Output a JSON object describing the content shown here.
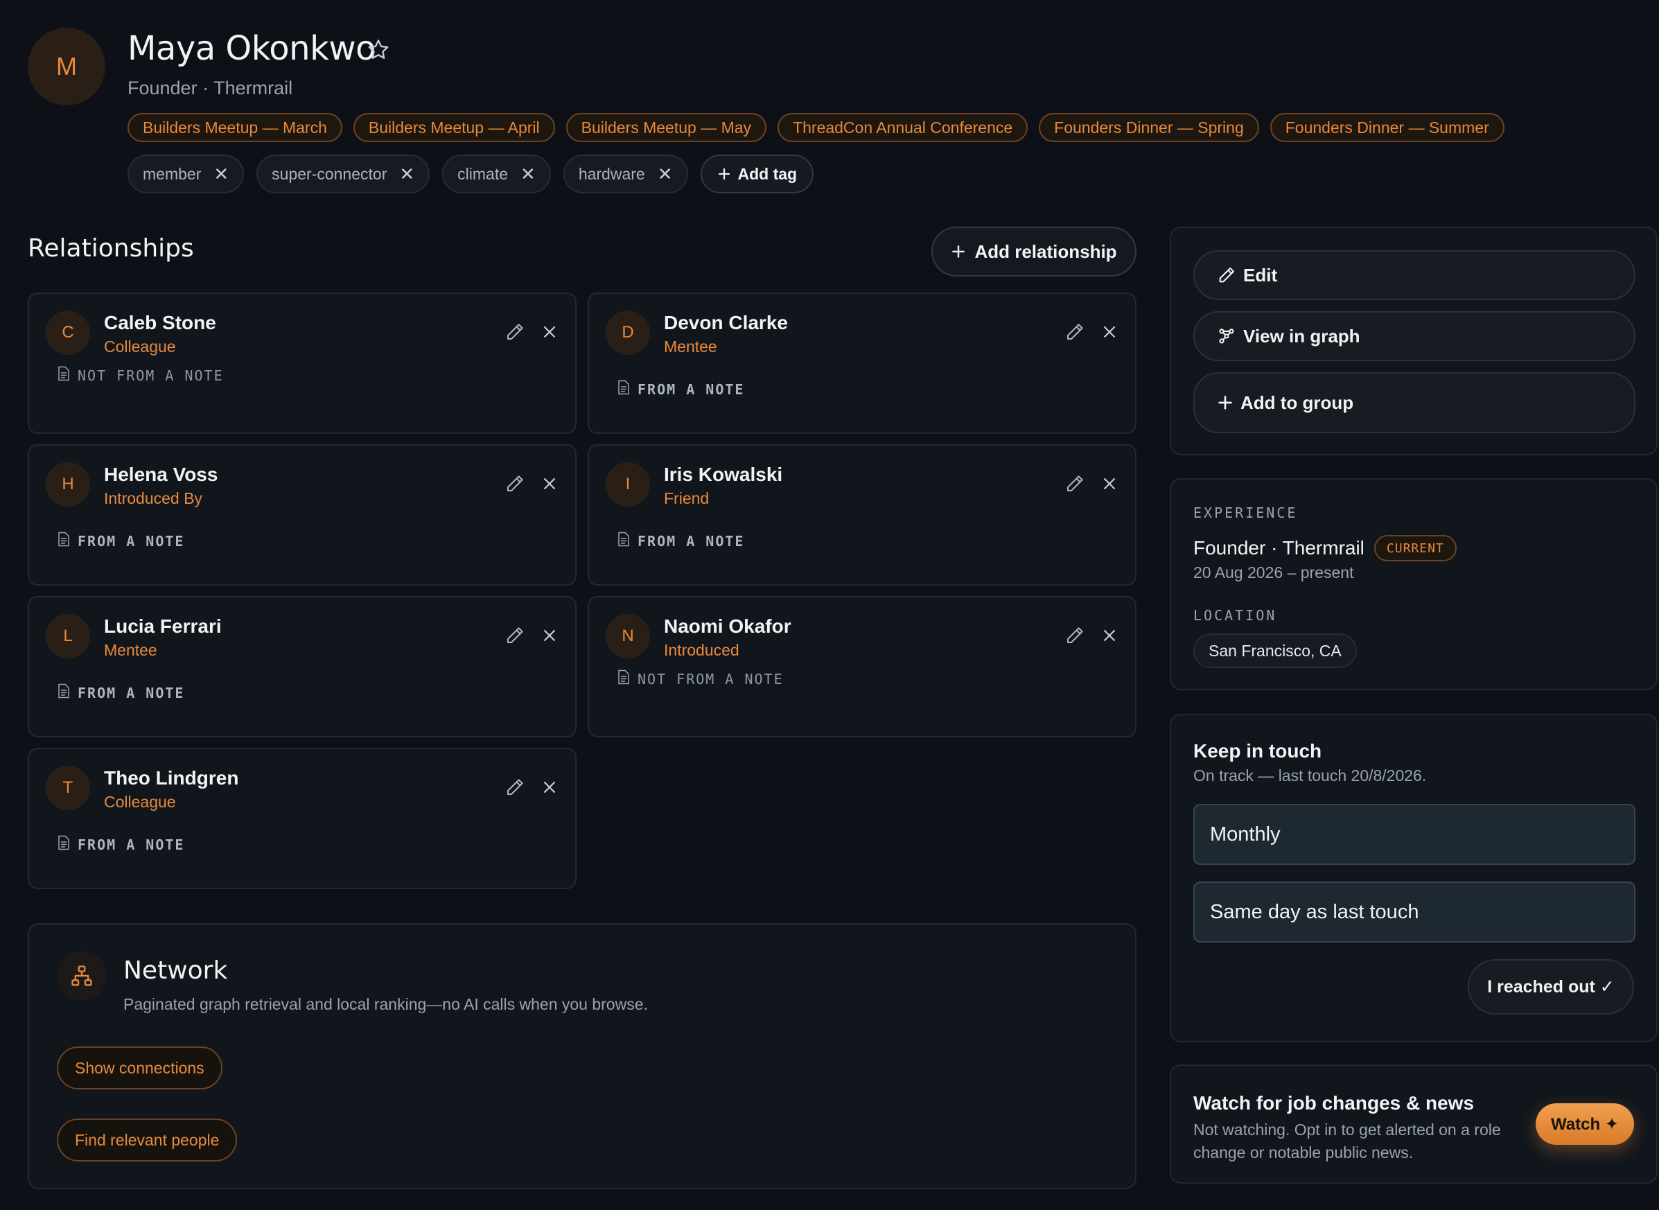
{
  "profile": {
    "initial": "M",
    "name": "Maya Okonkwo",
    "subtitle": "Founder · Thermrail"
  },
  "events": [
    "Builders Meetup — March",
    "Builders Meetup — April",
    "Builders Meetup — May",
    "ThreadCon Annual Conference",
    "Founders Dinner — Spring",
    "Founders Dinner — Summer"
  ],
  "tags": [
    "member",
    "super-connector",
    "climate",
    "hardware"
  ],
  "tag_remove_glyph": "✕",
  "add_tag_label": "Add tag",
  "relationships": {
    "title": "Relationships",
    "add_label": "Add relationship",
    "cards": [
      {
        "initial": "C",
        "name": "Caleb Stone",
        "role": "Colleague",
        "note": "NOT FROM A NOTE"
      },
      {
        "initial": "D",
        "name": "Devon Clarke",
        "role": "Mentee",
        "note": "FROM A NOTE"
      },
      {
        "initial": "H",
        "name": "Helena Voss",
        "role": "Introduced By",
        "note": "FROM A NOTE"
      },
      {
        "initial": "I",
        "name": "Iris Kowalski",
        "role": "Friend",
        "note": "FROM A NOTE"
      },
      {
        "initial": "L",
        "name": "Lucia Ferrari",
        "role": "Mentee",
        "note": "FROM A NOTE"
      },
      {
        "initial": "N",
        "name": "Naomi Okafor",
        "role": "Introduced",
        "note": "NOT FROM A NOTE"
      },
      {
        "initial": "T",
        "name": "Theo Lindgren",
        "role": "Colleague",
        "note": "FROM A NOTE"
      }
    ]
  },
  "network": {
    "title": "Network",
    "description": "Paginated graph retrieval and local ranking—no AI calls when you browse.",
    "show_connections": "Show connections",
    "find_people": "Find relevant people"
  },
  "actions": {
    "edit": "Edit",
    "view_graph": "View in graph",
    "add_group": "Add to group"
  },
  "experience": {
    "label": "EXPERIENCE",
    "title": "Founder · Thermrail",
    "badge": "CURRENT",
    "dates": "20 Aug 2026 – present",
    "location_label": "LOCATION",
    "location": "San Francisco, CA"
  },
  "keep_in_touch": {
    "title": "Keep in touch",
    "status": "On track — last touch 20/8/2026.",
    "frequency": "Monthly",
    "anchor": "Same day as last touch",
    "reached_out": "I reached out ✓"
  },
  "watch": {
    "title": "Watch for job changes & news",
    "description": "Not watching. Opt in to get alerted on a role change or notable public news.",
    "button": "Watch ✦"
  },
  "colors": {
    "accent": "#e8893a",
    "background": "#0d1117",
    "card": "#11161d"
  }
}
